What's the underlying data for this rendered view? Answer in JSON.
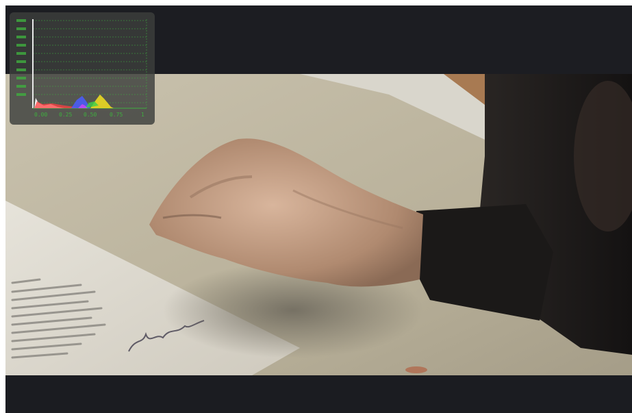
{
  "player": {
    "state": "paused",
    "scene_description": "hand resting near signed document on table"
  },
  "histogram": {
    "x_ticks": [
      "0.00",
      "0.25",
      "0.50",
      "0.75",
      "1"
    ],
    "grid_color": "#3fae3f",
    "label_color": "#3fae3f",
    "channels": [
      "red",
      "green",
      "blue",
      "luma"
    ]
  },
  "colors": {
    "frame_bg": "#1c1d22",
    "panel_bg": "#3c3e3c",
    "accent_green": "#3fae3f"
  }
}
